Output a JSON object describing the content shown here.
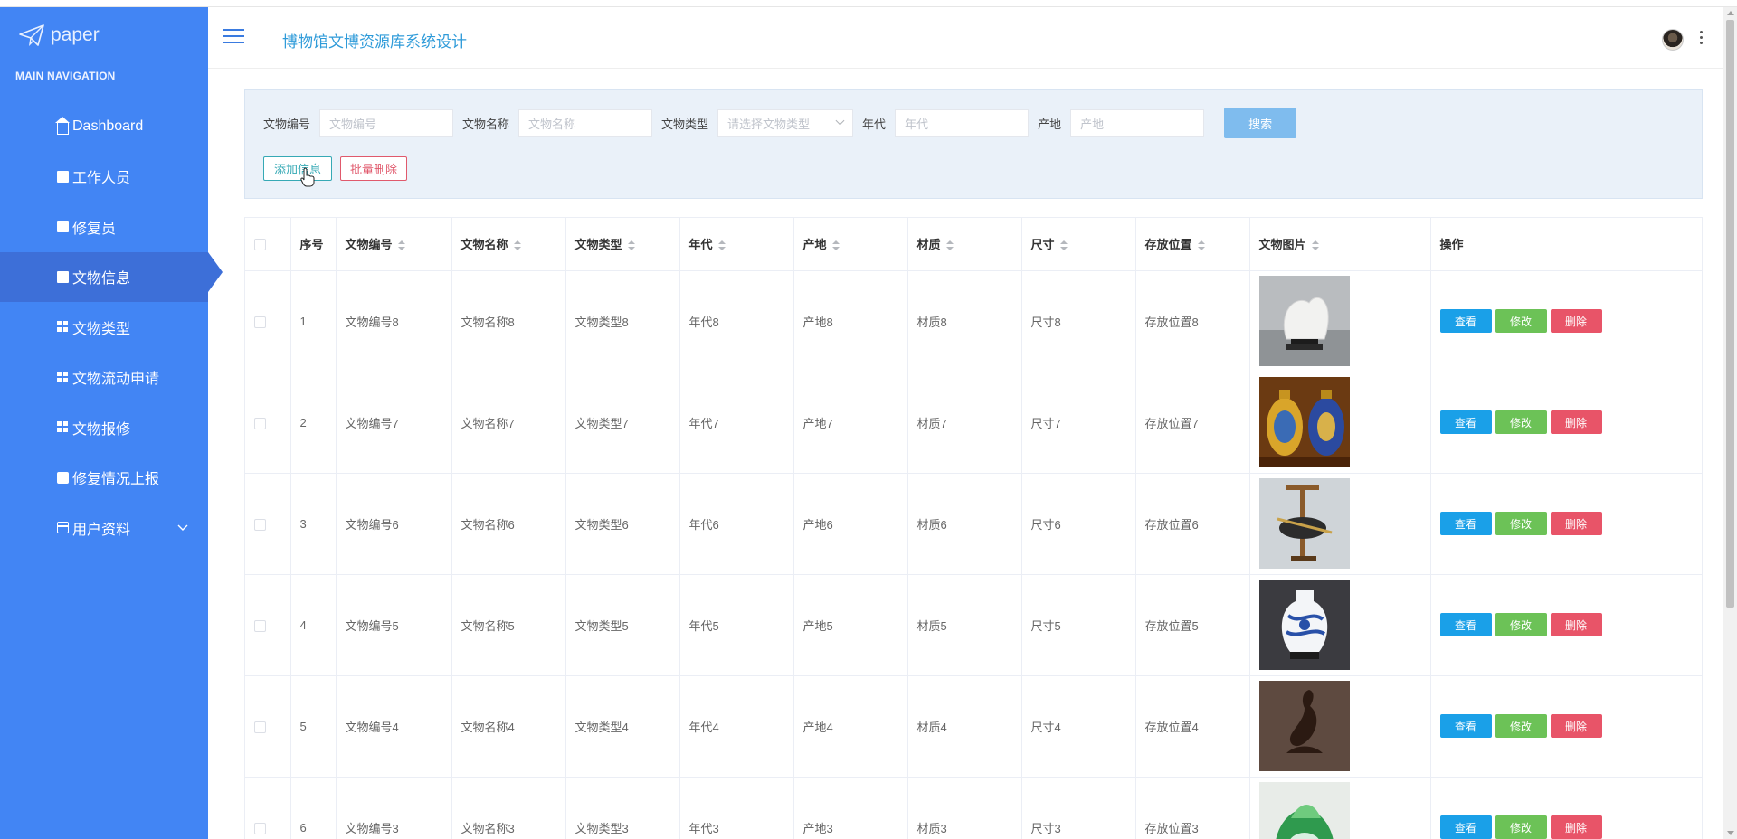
{
  "brand": {
    "name": "paper"
  },
  "sidebar": {
    "header": "MAIN NAVIGATION",
    "items": [
      {
        "label": "Dashboard",
        "icon": "home-icon"
      },
      {
        "label": "工作人员",
        "icon": "square-icon"
      },
      {
        "label": "修复员",
        "icon": "clipboard-icon"
      },
      {
        "label": "文物信息",
        "icon": "clipboard-icon",
        "active": true
      },
      {
        "label": "文物类型",
        "icon": "grid-icon"
      },
      {
        "label": "文物流动申请",
        "icon": "grid-icon"
      },
      {
        "label": "文物报修",
        "icon": "grid-icon"
      },
      {
        "label": "修复情况上报",
        "icon": "comment-icon"
      },
      {
        "label": "用户资料",
        "icon": "card-icon",
        "has_children": true
      }
    ]
  },
  "header": {
    "title": "博物馆文博资源库系统设计"
  },
  "search": {
    "fields": [
      {
        "label": "文物编号",
        "placeholder": "文物编号"
      },
      {
        "label": "文物名称",
        "placeholder": "文物名称"
      },
      {
        "label": "文物类型",
        "placeholder": "请选择文物类型"
      },
      {
        "label": "年代",
        "placeholder": "年代"
      },
      {
        "label": "产地",
        "placeholder": "产地"
      }
    ],
    "search_button": "搜索",
    "add_button": "添加信息",
    "batch_delete_button": "批量删除"
  },
  "table": {
    "columns": [
      "序号",
      "文物编号",
      "文物名称",
      "文物类型",
      "年代",
      "产地",
      "材质",
      "尺寸",
      "存放位置",
      "文物图片",
      "操作"
    ],
    "actions": {
      "view": "查看",
      "edit": "修改",
      "delete": "删除"
    },
    "rows": [
      {
        "no": "1",
        "code": "文物编号8",
        "name": "文物名称8",
        "type": "文物类型8",
        "era": "年代8",
        "origin": "产地8",
        "material": "材质8",
        "size": "尺寸8",
        "location": "存放位置8"
      },
      {
        "no": "2",
        "code": "文物编号7",
        "name": "文物名称7",
        "type": "文物类型7",
        "era": "年代7",
        "origin": "产地7",
        "material": "材质7",
        "size": "尺寸7",
        "location": "存放位置7"
      },
      {
        "no": "3",
        "code": "文物编号6",
        "name": "文物名称6",
        "type": "文物类型6",
        "era": "年代6",
        "origin": "产地6",
        "material": "材质6",
        "size": "尺寸6",
        "location": "存放位置6"
      },
      {
        "no": "4",
        "code": "文物编号5",
        "name": "文物名称5",
        "type": "文物类型5",
        "era": "年代5",
        "origin": "产地5",
        "material": "材质5",
        "size": "尺寸5",
        "location": "存放位置5"
      },
      {
        "no": "5",
        "code": "文物编号4",
        "name": "文物名称4",
        "type": "文物类型4",
        "era": "年代4",
        "origin": "产地4",
        "material": "材质4",
        "size": "尺寸4",
        "location": "存放位置4"
      },
      {
        "no": "6",
        "code": "文物编号3",
        "name": "文物名称3",
        "type": "文物类型3",
        "era": "年代3",
        "origin": "产地3",
        "material": "材质3",
        "size": "尺寸3",
        "location": "存放位置3"
      }
    ]
  },
  "colors": {
    "sidebar": "#4285f4",
    "title": "#2f9bd9",
    "view": "#1aa0e8",
    "edit": "#6cc257",
    "delete": "#e85468"
  }
}
